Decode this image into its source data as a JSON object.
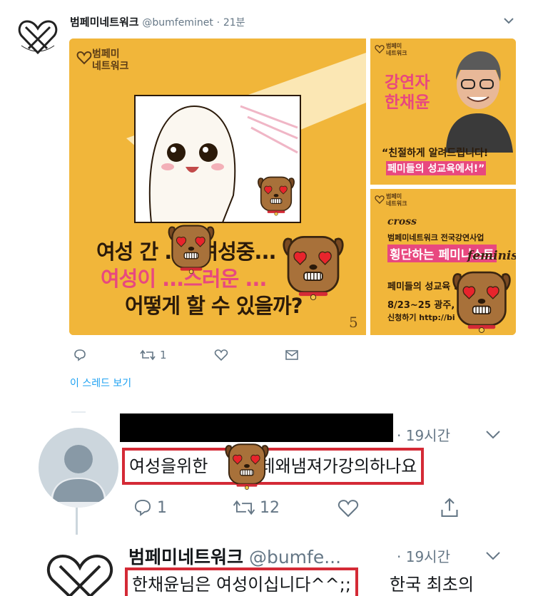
{
  "tweet": {
    "author_name": "범페미네트워크",
    "author_handle": "@bumfeminet",
    "separator": "·",
    "time": "21분",
    "actions": {
      "retweet_count": "1"
    },
    "thread_link": "이 스레드 보기"
  },
  "media": {
    "main_panel": {
      "brand_line1": "범페미",
      "brand_line2": "네트워크",
      "line1": "여성 간 ..., 여성중...",
      "line2": "여성이 ...스러운 ...",
      "line3": "어떻게 할 수 있을까?",
      "page_number": "5"
    },
    "top_right_panel": {
      "brand_line1": "범페미",
      "brand_line2": "네트워크",
      "title_line1": "강연자",
      "title_line2": "한채윤",
      "quote_line1": "“친절하게 알려드립니다!",
      "quote_line2": "페미들의 성교육에서!”"
    },
    "bottom_right_panel": {
      "brand_line1": "범페미",
      "brand_line2": "네트워크",
      "cross": "cross",
      "line1": "범페미네트워크 전국강연사업",
      "line2": "횡단하는 페미니스트",
      "feminist": "feminist",
      "line3": "페미들의 성교육 :",
      "line4": "8/23~25 광주,",
      "line5": "신청하기 http://bi"
    }
  },
  "reply1": {
    "time": "· 19시간",
    "text_before": "여성을위한",
    "text_after": "인데왜냄져가강의하나요",
    "reply_count": "1",
    "retweet_count": "12"
  },
  "reply2": {
    "author_name": "범페미네트워크",
    "author_handle": "@bumfe...",
    "time": "· 19시간",
    "text_highlighted": "한채윤님은 여성이십니다^^;;",
    "text_rest": "한국 최초의"
  },
  "colors": {
    "brand_orange": "#f1b63a",
    "highlight_red": "#d42a36",
    "accent_pink": "#e8487f",
    "twitter_gray": "#657786",
    "twitter_blue": "#1da1f2"
  }
}
